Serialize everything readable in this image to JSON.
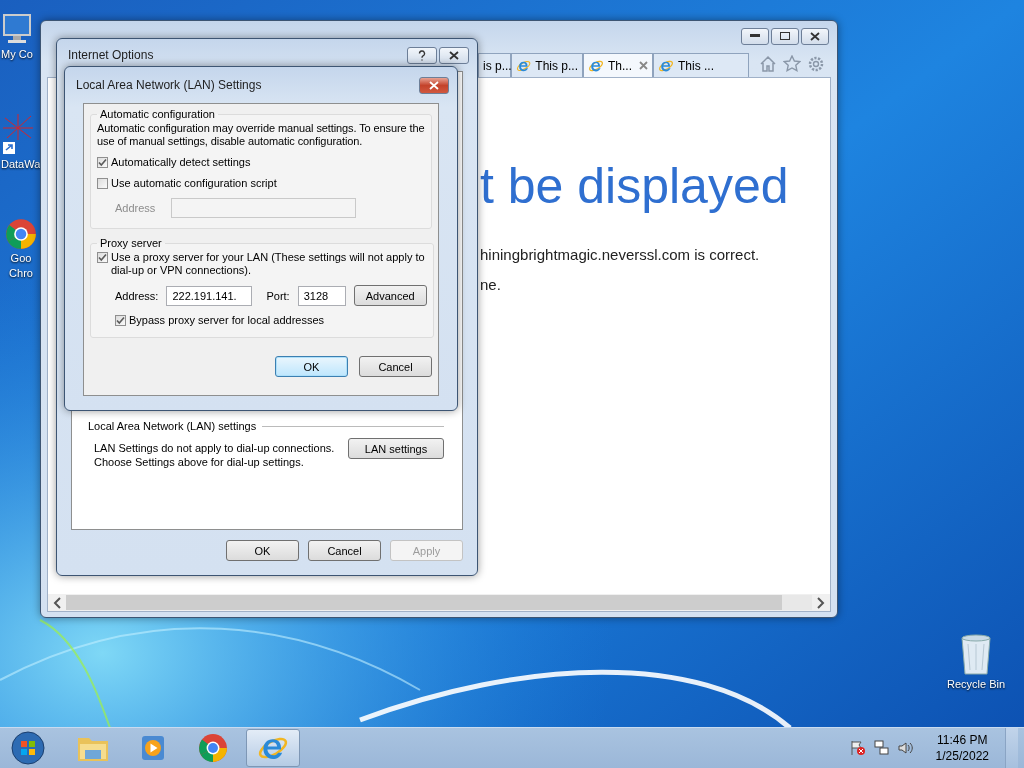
{
  "desktop_icons": [
    {
      "kind": "computer",
      "lines": [
        "My Co"
      ]
    },
    {
      "kind": "network",
      "lines": [
        "DataWa"
      ]
    },
    {
      "kind": "chrome",
      "lines": [
        "Goo",
        "Chro"
      ]
    },
    {
      "kind": "recycle",
      "lines": [
        "Recycle Bin"
      ]
    }
  ],
  "browser": {
    "tabs": [
      {
        "title": "is p...",
        "icon": false,
        "selected": false
      },
      {
        "title": "This p...",
        "icon": true,
        "selected": false
      },
      {
        "title": "Th...",
        "icon": true,
        "selected": true
      },
      {
        "title": "This ...",
        "icon": true,
        "selected": false
      }
    ],
    "heading": "t be displayed",
    "lines": [
      "hiningbrightmagic.neverssl.com is correct.",
      "ne."
    ]
  },
  "internet_options": {
    "title": "Internet Options",
    "lan_group": {
      "title": "Local Area Network (LAN) settings",
      "lines": [
        "LAN Settings do not apply to dial-up connections.",
        "Choose Settings above for dial-up settings."
      ],
      "button": "LAN settings"
    },
    "buttons": [
      {
        "label": "OK",
        "disabled": false
      },
      {
        "label": "Cancel",
        "disabled": false
      },
      {
        "label": "Apply",
        "disabled": true
      }
    ]
  },
  "lan_dialog": {
    "title": "Local Area Network (LAN) Settings",
    "auto_group": {
      "title": "Automatic configuration",
      "description": "Automatic configuration may override manual settings.  To ensure the use of manual settings, disable automatic configuration.",
      "options": [
        {
          "label": "Automatically detect settings",
          "checked": true
        },
        {
          "label": "Use automatic configuration script",
          "checked": false
        }
      ],
      "address": {
        "label": "Address",
        "disabled": true
      }
    },
    "proxy_group": {
      "title": "Proxy server",
      "use_proxy": {
        "label": "Use a proxy server for your LAN (These settings will not apply to dial-up or VPN connections).",
        "checked": true
      },
      "address": {
        "label": "Address:",
        "value": "222.191.141."
      },
      "port": {
        "label": "Port:",
        "value": "3128"
      },
      "advanced": "Advanced",
      "bypass": {
        "label": "Bypass proxy server for local addresses",
        "checked": true
      }
    },
    "buttons": [
      {
        "label": "OK",
        "default": true
      },
      {
        "label": "Cancel",
        "default": false
      }
    ]
  },
  "taskbar": {
    "apps": [
      {
        "kind": "explorer",
        "active": false
      },
      {
        "kind": "media",
        "active": false
      },
      {
        "kind": "chrome",
        "active": false
      },
      {
        "kind": "ie",
        "active": true
      }
    ],
    "time": "11:46 PM",
    "date": "1/25/2022"
  }
}
